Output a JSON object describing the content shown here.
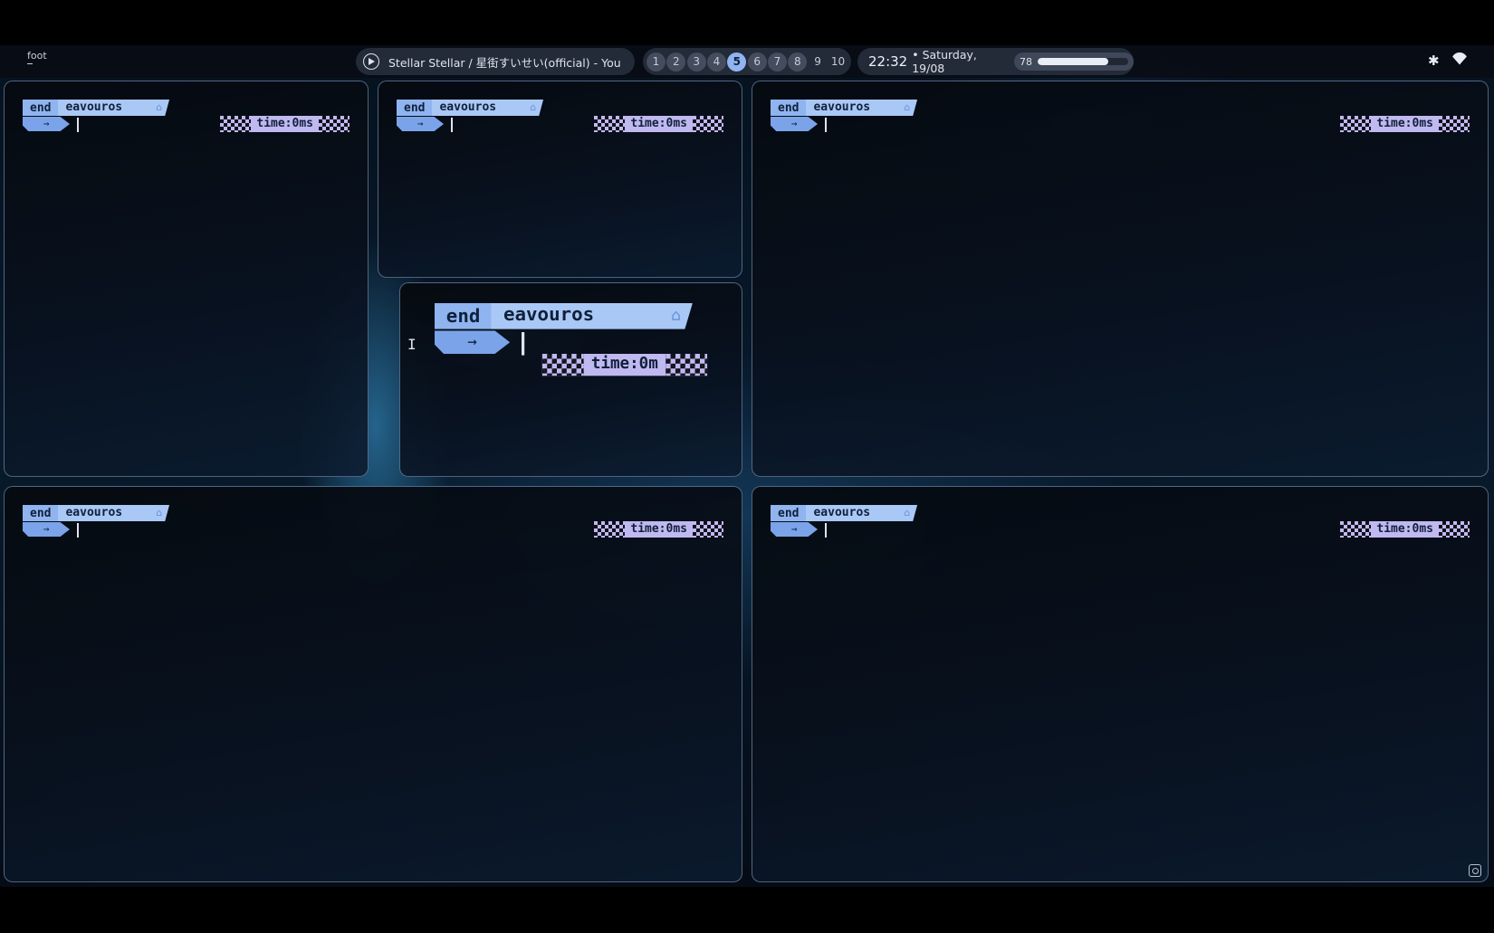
{
  "app": {
    "active_window": "foot"
  },
  "media": {
    "title": "Stellar Stellar / 星街すいせい(official) - You"
  },
  "workspaces": {
    "items": [
      "1",
      "2",
      "3",
      "4",
      "5",
      "6",
      "7",
      "8",
      "9",
      "10"
    ],
    "active": "5"
  },
  "clock": {
    "time": "22:32",
    "date": "• Saturday, 19/08"
  },
  "battery": {
    "percent": "78",
    "level": 0.78
  },
  "colors": {
    "accent": "#8fb4f0",
    "prompt_segment": "#a9c8f6",
    "rprompt": "#c0b8f0"
  },
  "icons": {
    "media": "play-circle-icon",
    "bluetooth": "bluetooth-icon",
    "wifi": "wifi-icon",
    "corner": "screenshot-icon"
  },
  "terminals": [
    {
      "prompt_first": "end",
      "prompt_second": "eavouros",
      "arrow": "→",
      "rprompt": "time:0ms"
    },
    {
      "prompt_first": "end",
      "prompt_second": "eavouros",
      "arrow": "→",
      "rprompt": "time:0ms"
    },
    {
      "prompt_first": "end",
      "prompt_second": "eavouros",
      "arrow": "→",
      "rprompt": "time:0ms"
    },
    {
      "prompt_first": "end",
      "prompt_second": "eavouros",
      "arrow": "→",
      "rprompt": "time:0m"
    },
    {
      "prompt_first": "end",
      "prompt_second": "eavouros",
      "arrow": "→",
      "rprompt": "time:0ms"
    },
    {
      "prompt_first": "end",
      "prompt_second": "eavouros",
      "arrow": "→",
      "rprompt": "time:0ms"
    }
  ]
}
